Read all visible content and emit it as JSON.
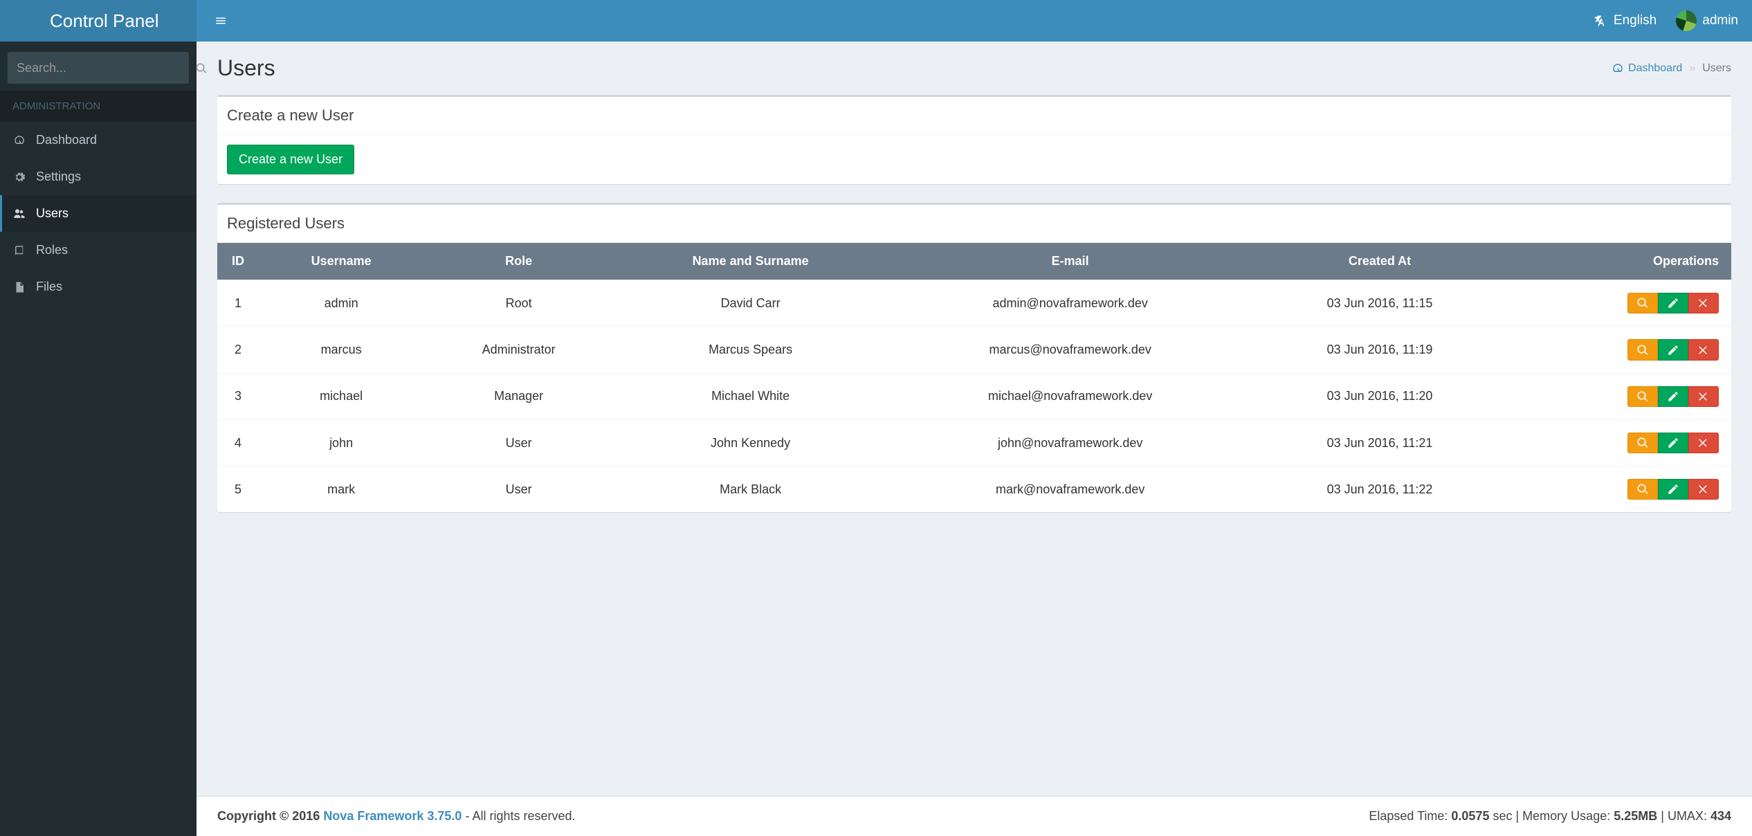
{
  "brand": "Control Panel",
  "search": {
    "placeholder": "Search..."
  },
  "sidebar": {
    "section": "ADMINISTRATION",
    "items": [
      {
        "label": "Dashboard"
      },
      {
        "label": "Settings"
      },
      {
        "label": "Users"
      },
      {
        "label": "Roles"
      },
      {
        "label": "Files"
      }
    ]
  },
  "header": {
    "language": "English",
    "user": "admin"
  },
  "page": {
    "title": "Users",
    "breadcrumb_home": "Dashboard",
    "breadcrumb_current": "Users"
  },
  "create_box": {
    "title": "Create a new User",
    "button": "Create a new User"
  },
  "table_box": {
    "title": "Registered Users",
    "columns": [
      "ID",
      "Username",
      "Role",
      "Name and Surname",
      "E-mail",
      "Created At",
      "Operations"
    ],
    "rows": [
      {
        "id": "1",
        "username": "admin",
        "role": "Root",
        "name": "David Carr",
        "email": "admin@novaframework.dev",
        "created": "03 Jun 2016, 11:15"
      },
      {
        "id": "2",
        "username": "marcus",
        "role": "Administrator",
        "name": "Marcus Spears",
        "email": "marcus@novaframework.dev",
        "created": "03 Jun 2016, 11:19"
      },
      {
        "id": "3",
        "username": "michael",
        "role": "Manager",
        "name": "Michael White",
        "email": "michael@novaframework.dev",
        "created": "03 Jun 2016, 11:20"
      },
      {
        "id": "4",
        "username": "john",
        "role": "User",
        "name": "John Kennedy",
        "email": "john@novaframework.dev",
        "created": "03 Jun 2016, 11:21"
      },
      {
        "id": "5",
        "username": "mark",
        "role": "User",
        "name": "Mark Black",
        "email": "mark@novaframework.dev",
        "created": "03 Jun 2016, 11:22"
      }
    ]
  },
  "footer": {
    "copyright_prefix": "Copyright © 2016 ",
    "link_text": "Nova Framework 3.75.0",
    "copyright_suffix": " - All rights reserved.",
    "stats_prefix": "Elapsed Time: ",
    "elapsed": "0.0575",
    "stats_mid1": " sec | Memory Usage: ",
    "memory": "5.25MB",
    "stats_mid2": " | UMAX: ",
    "umax": "434"
  }
}
